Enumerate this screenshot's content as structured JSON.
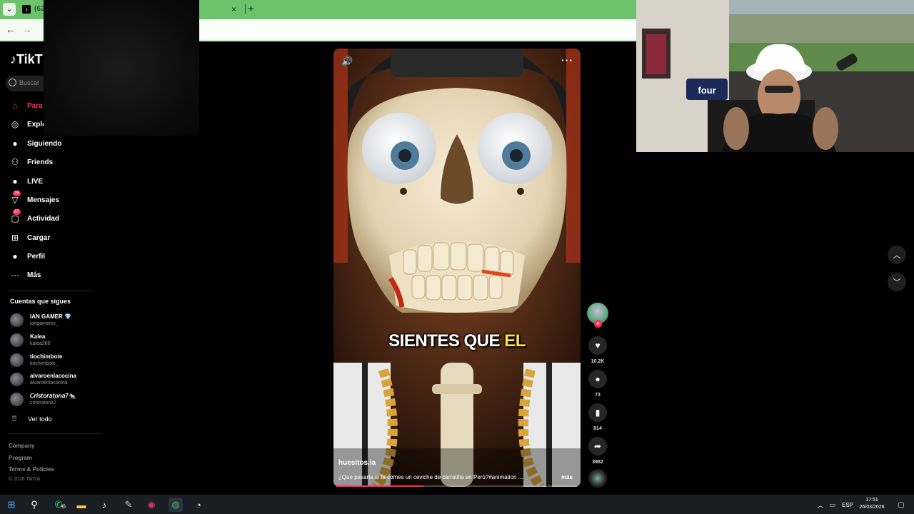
{
  "browser": {
    "tab_title": "(62)",
    "tab_close": "×",
    "new_tab": "+",
    "dropdown": "⌄",
    "back": "←",
    "forward": "→"
  },
  "sidebar": {
    "logo": "TikT",
    "search_placeholder": "Buscar",
    "nav": [
      {
        "label": "Para",
        "icon": "home-icon",
        "glyph": "⌂",
        "active": true
      },
      {
        "label": "Explo",
        "icon": "compass-icon",
        "glyph": "◎"
      },
      {
        "label": "Siguiendo",
        "icon": "following-icon",
        "glyph": "●"
      },
      {
        "label": "Friends",
        "icon": "friends-icon",
        "glyph": "⚇"
      },
      {
        "label": "LIVE",
        "icon": "live-icon",
        "glyph": "●"
      },
      {
        "label": "Mensajes",
        "icon": "messages-icon",
        "glyph": "▽",
        "badge": "25"
      },
      {
        "label": "Actividad",
        "icon": "activity-icon",
        "glyph": "▢",
        "badge": "37"
      },
      {
        "label": "Cargar",
        "icon": "upload-icon",
        "glyph": "⊞"
      },
      {
        "label": "Perfil",
        "icon": "profile-icon",
        "glyph": "●"
      },
      {
        "label": "Más",
        "icon": "more-icon",
        "glyph": "···"
      }
    ],
    "following_header": "Cuentas que sigues",
    "accounts": [
      {
        "name": "IAN GAMER 💎",
        "handle": "iangamersc_"
      },
      {
        "name": "Kalea",
        "handle": "kalea266"
      },
      {
        "name": "tiochimbote",
        "handle": "tiochimbote_"
      },
      {
        "name": "alvaroenlacocina",
        "handle": "alvaroenlacocina"
      },
      {
        "name": "𝘊𝘳𝘪𝘴𝘵𝘰𝘳𝘢𝘵𝘰𝘯𝘢7🐀",
        "handle": "critoratona7"
      }
    ],
    "see_all": "Ver todo",
    "footer": [
      "Company",
      "Program",
      "Terms & Policies"
    ],
    "copyright": "© 2026 TikTok"
  },
  "video": {
    "caption_main": "SIENTES QUE ",
    "caption_highlight": "EL",
    "author": "huesitos.ia",
    "description": "¿Que pasaría si te comes un ceviche de carretilla en Perú?#animation ...",
    "more": "más",
    "progress": 0.36,
    "volume_icon": "🔊",
    "menu_icon": "···"
  },
  "actions": {
    "likes": "10.2K",
    "comments": "73",
    "saves": "814",
    "shares": "3982"
  },
  "taskbar": {
    "whatsapp_badge": "45",
    "lang": "ESP",
    "time": "17:51",
    "date": "26/03/2026"
  },
  "colors": {
    "accent": "#fe2c55",
    "tab_green": "#6cc36c",
    "caption_highlight": "#ffe14d"
  }
}
